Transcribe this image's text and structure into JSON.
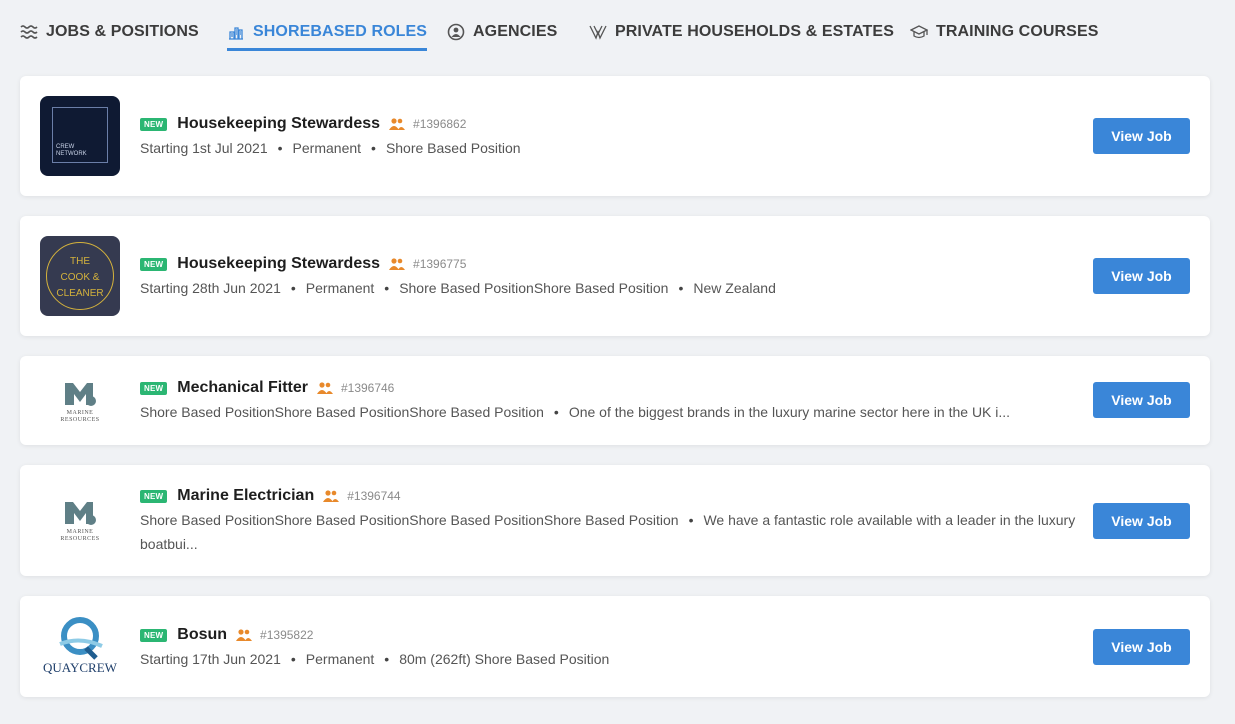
{
  "tabs": [
    {
      "label": "JOBS & POSITIONS",
      "icon": "waves-icon"
    },
    {
      "label": "SHOREBASED ROLES",
      "icon": "building-icon"
    },
    {
      "label": "AGENCIES",
      "icon": "person-circle-icon"
    },
    {
      "label": "PRIVATE HOUSEHOLDS & ESTATES",
      "icon": "estate-icon"
    },
    {
      "label": "TRAINING COURSES",
      "icon": "graduation-cap-icon"
    }
  ],
  "active_tab": "SHOREBASED ROLES",
  "badge_label": "NEW",
  "button_label": "View Job",
  "colors": {
    "accent": "#3a86d8",
    "badge": "#2bb673",
    "people_icon": "#e8892b"
  },
  "logos": {
    "crew_network": {
      "line1": "CREW",
      "line2": "NETWORK"
    },
    "cook_cleaner": {
      "line1": "THE",
      "line2": "COOK &",
      "line3": "CLEANER"
    },
    "marine_resources": {
      "line1": "MARINE",
      "line2": "RESOURCES"
    },
    "quaycrew": {
      "text": "QUAYCREW"
    }
  },
  "jobs": [
    {
      "title": "Housekeeping Stewardess",
      "ref": "#1396862",
      "meta": [
        "Starting 1st Jul 2021",
        "Permanent",
        "Shore Based Position"
      ]
    },
    {
      "title": "Housekeeping Stewardess",
      "ref": "#1396775",
      "meta": [
        "Starting 28th Jun 2021",
        "Permanent",
        "Shore Based PositionShore Based Position",
        "New Zealand"
      ]
    },
    {
      "title": "Mechanical Fitter",
      "ref": "#1396746",
      "meta": [
        "Shore Based PositionShore Based PositionShore Based Position",
        "One of the biggest brands in the luxury marine sector here in the UK i..."
      ]
    },
    {
      "title": "Marine Electrician",
      "ref": "#1396744",
      "meta": [
        "Shore Based PositionShore Based PositionShore Based PositionShore Based Position",
        "We have a fantastic role available with a leader in the luxury boatbui..."
      ]
    },
    {
      "title": "Bosun",
      "ref": "#1395822",
      "meta": [
        "Starting 17th Jun 2021",
        "Permanent",
        "80m (262ft) Shore Based Position"
      ]
    }
  ]
}
